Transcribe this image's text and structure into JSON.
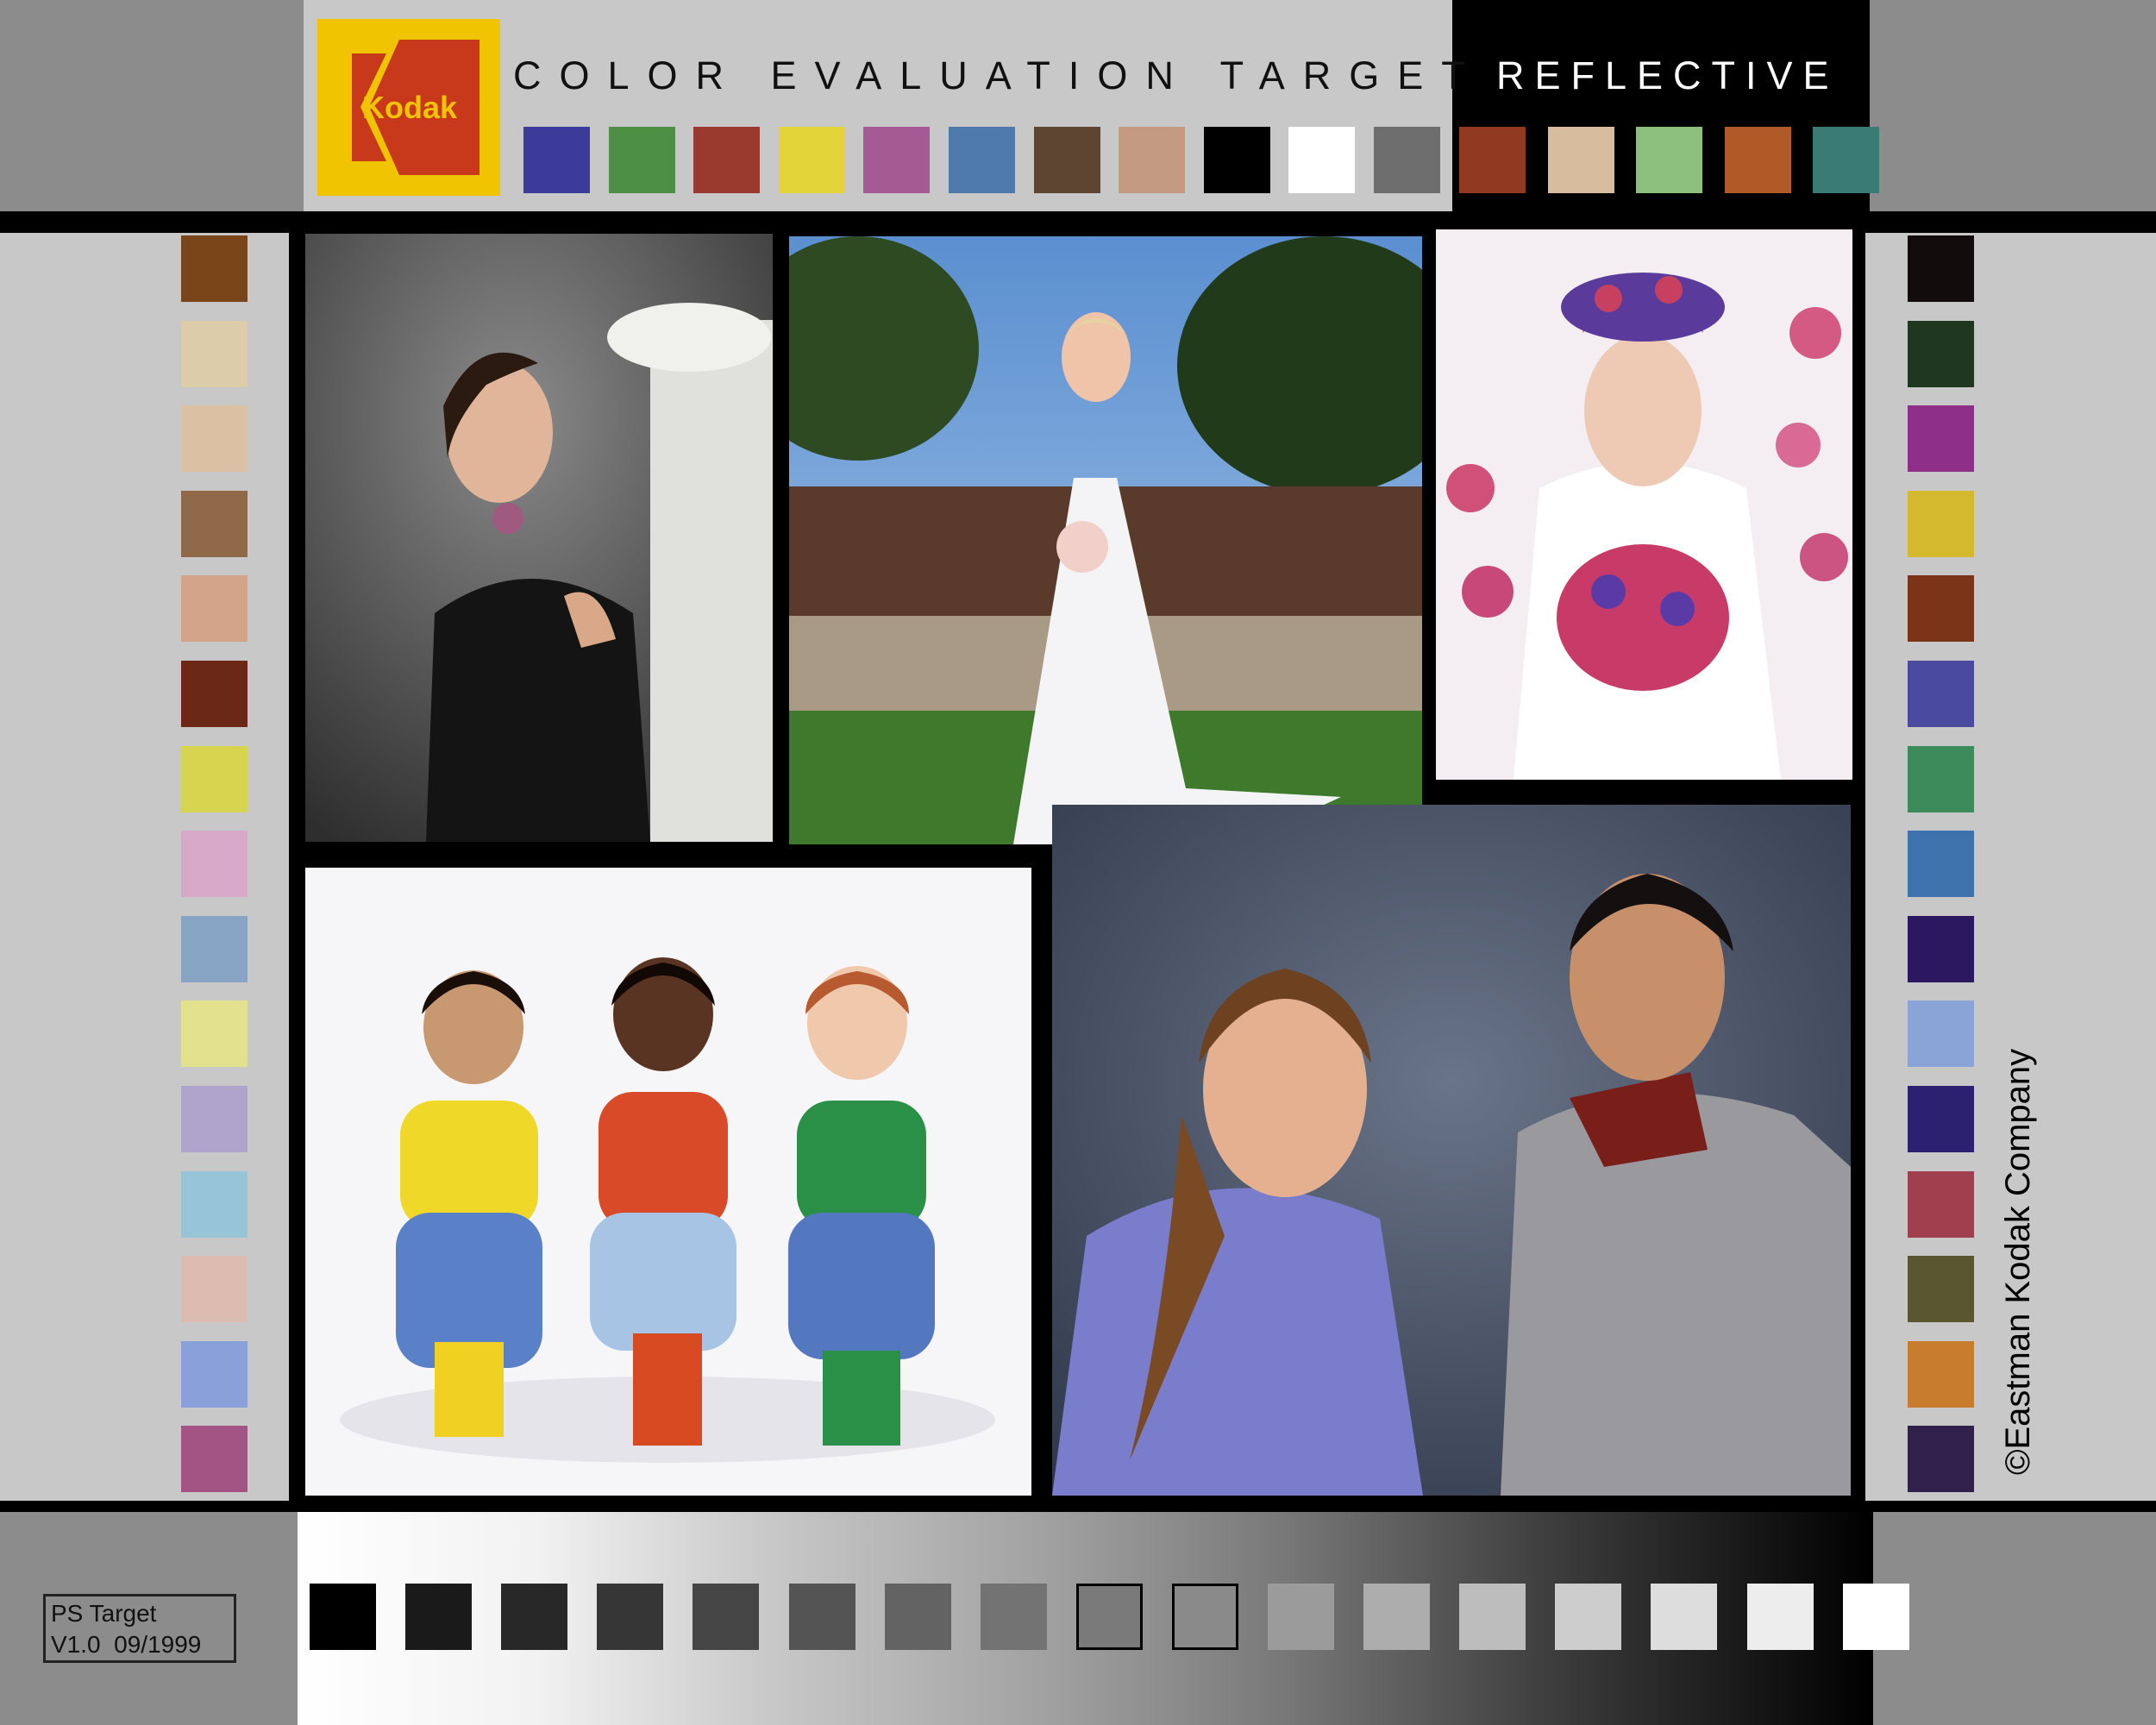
{
  "header": {
    "logo_text": "Kodak",
    "title": "COLOR EVALUATION TARGET",
    "subtitle": "REFLECTIVE"
  },
  "colors": {
    "outer_gray": "#8c8c8c",
    "panel_gray": "#c8c8c8",
    "frame_black": "#000000",
    "kodak_yellow": "#f0c400",
    "kodak_red": "#c8381a"
  },
  "top_swatches": [
    "#3b3b9a",
    "#4c8f45",
    "#9a3a2e",
    "#e3d43a",
    "#a55a94",
    "#4d7aab",
    "#5e4532",
    "#c49a82",
    "#000000",
    "#ffffff",
    "#6e6e6e",
    "#913a20",
    "#d8bc9e",
    "#8cbf7e",
    "#b05a28",
    "#3a7b73"
  ],
  "left_swatches": [
    "#7a4519",
    "#dcccaa",
    "#dcc0a3",
    "#906a48",
    "#d4a48a",
    "#6c2816",
    "#d7d450",
    "#d8a8c8",
    "#88a4c4",
    "#e3e08e",
    "#aea4cc",
    "#98c4d8",
    "#dcbcb0",
    "#8aa0d8",
    "#a45484"
  ],
  "right_swatches": [
    "#120c0c",
    "#20371f",
    "#8e2f8a",
    "#d4b82e",
    "#7c3418",
    "#4a4a9e",
    "#3d8a5a",
    "#3e72ac",
    "#2c1860",
    "#8aa4d8",
    "#2c2070",
    "#a0404e",
    "#5a5630",
    "#c87c2e",
    "#32204c"
  ],
  "gray_steps": [
    "#000000",
    "#1a1a1a",
    "#282828",
    "#363636",
    "#454545",
    "#545454",
    "#636363",
    "#737373",
    "#7a7a7a",
    "#8a8a8a",
    "#9b9b9b",
    "#adadad",
    "#bdbdbd",
    "#cdcdcd",
    "#dddddd",
    "#ededed",
    "#ffffff"
  ],
  "photos": [
    {
      "name": "woman-looking-up-photo"
    },
    {
      "name": "bride-garden-photo"
    },
    {
      "name": "bride-flowers-photo"
    },
    {
      "name": "three-girls-photo"
    },
    {
      "name": "couple-portrait-photo"
    }
  ],
  "copyright": "©Eastman Kodak Company",
  "ps_target": {
    "line1": "PS Target",
    "line2": "V1.0  09/1999"
  }
}
